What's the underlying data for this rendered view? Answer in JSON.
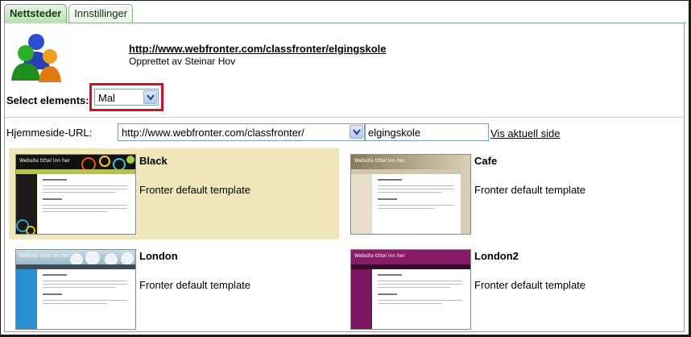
{
  "tabs": [
    {
      "label": "Nettsteder",
      "active": true
    },
    {
      "label": "Innstillinger",
      "active": false
    }
  ],
  "site": {
    "url": "http://www.webfronter.com/classfronter/elgingskole",
    "created_by": "Opprettet av Steinar Hov"
  },
  "elements": {
    "label": "Select elements:",
    "selected": "Mal"
  },
  "homepage": {
    "label": "Hjemmeside-URL:",
    "base_url": "http://www.webfronter.com/classfronter/",
    "path": "elgingskole",
    "view_link": "Vis aktuell side"
  },
  "templates": [
    {
      "name": "Black",
      "description": "Fronter default template",
      "selected": true,
      "thumb_title": "Website tittel inn her",
      "header_color": "#111111",
      "nav_color": "#b6c24a",
      "side_color": "#1a1a1a"
    },
    {
      "name": "Cafe",
      "description": "Fronter default template",
      "selected": false,
      "thumb_title": "Website tittel inn her",
      "header_color": "#8a7a5a",
      "nav_color": "#cfc6ae",
      "side_color": "#e7dfc9"
    },
    {
      "name": "London",
      "description": "Fronter default template",
      "selected": false,
      "thumb_title": "Website tittel inn her",
      "header_color": "#9bb7c7",
      "nav_color": "#3d4d5a",
      "side_color": "#2c8fcf"
    },
    {
      "name": "London2",
      "description": "Fronter default template",
      "selected": false,
      "thumb_title": "Website tittel inn her",
      "header_color": "#8a1a6a",
      "nav_color": "#3a0a2a",
      "side_color": "#7a155f"
    }
  ],
  "colors": {
    "tab_active": "#b9deb0",
    "panel_border": "#7fb27f",
    "selected_template_bg": "#efe7b9",
    "highlight_box": "#d0102a"
  }
}
